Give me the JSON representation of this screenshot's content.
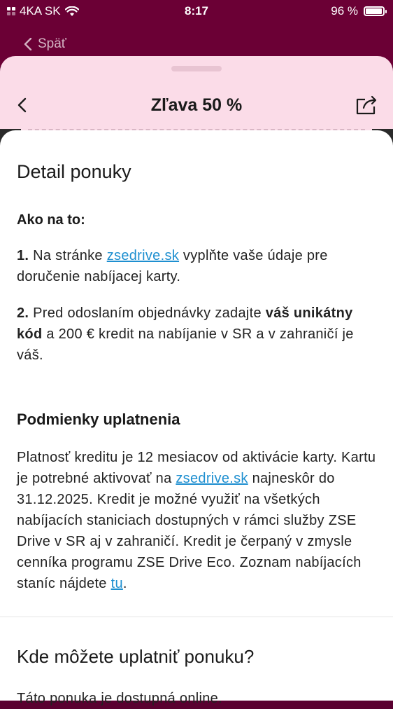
{
  "status": {
    "carrier": "4KA SK",
    "time": "8:17",
    "battery": "96 %",
    "battery_level": 0.96
  },
  "nav": {
    "back_label": "Späť"
  },
  "sheet": {
    "title": "Zľava 50 %"
  },
  "detail": {
    "heading": "Detail ponuky",
    "howto_heading": "Ako na to:",
    "step1": {
      "num": "1.",
      "text_before": "Na stránke",
      "link": "zsedrive.sk",
      "text_after": "vyplňte vaše údaje pre doručenie nabíjacej karty."
    },
    "step2": {
      "num": "2.",
      "text_before": "Pred odoslaním objednávky zadajte",
      "bold": "váš unikátny kód",
      "text_after": "a 200 € kredit na nabíjanie v SR a v zahraničí je váš."
    }
  },
  "conditions": {
    "heading": "Podmienky uplatnenia",
    "text1": "Platnosť kreditu je 12 mesiacov od aktivácie karty. Kartu je potrebné aktivovať na",
    "link1": "zsedrive.sk",
    "text2": "najneskôr do 31.12.2025. Kredit je možné využiť na všetkých nabíjacích staniciach dostupných v rámci služby ZSE Drive v SR aj v zahraničí. Kredit je čerpaný v zmysle cenníka programu ZSE Drive Eco. Zoznam nabíjacích staníc nájdete",
    "link2": "tu",
    "text3": "."
  },
  "where": {
    "heading": "Kde môžete uplatniť ponuku?",
    "text": "Táto ponuka je dostupná online."
  }
}
